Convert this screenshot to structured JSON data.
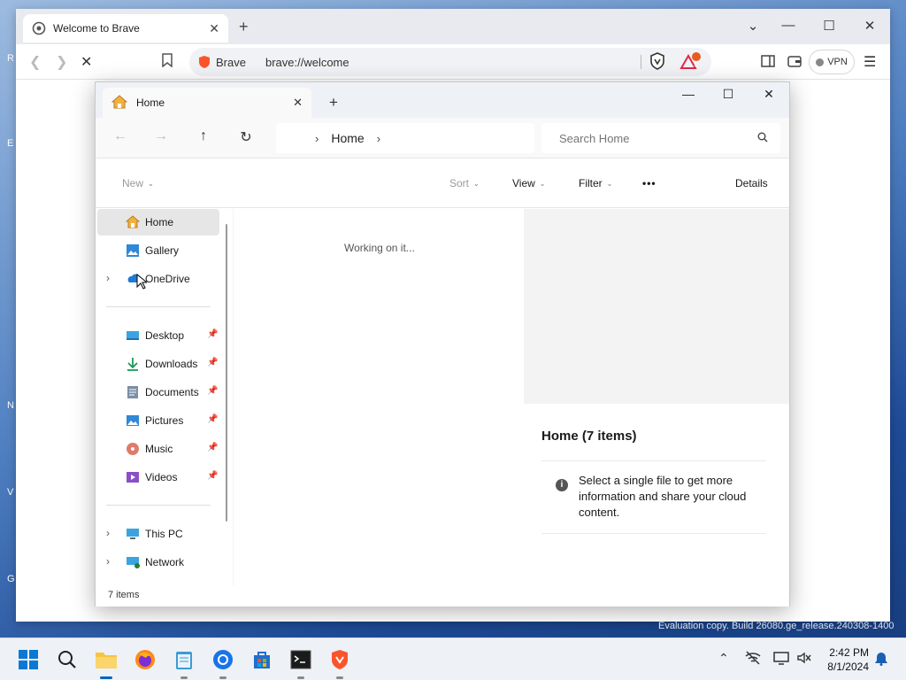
{
  "desktop": {
    "fragments": [
      "R",
      "E",
      "N",
      "V",
      "G"
    ]
  },
  "browser": {
    "tab_title": "Welcome to Brave",
    "site_label": "Brave",
    "url": "brave://welcome",
    "vpn_label": "VPN",
    "rewards_badge": "1",
    "icons": [
      "brave-icon",
      "close-icon",
      "plus-icon",
      "minimize-icon",
      "maximize-icon",
      "back-icon",
      "forward-icon",
      "stop-icon",
      "bookmark-icon",
      "shield-icon",
      "rewards-icon",
      "sidebar-icon",
      "wallet-icon",
      "menu-icon"
    ]
  },
  "explorer": {
    "tab_title": "Home",
    "breadcrumb": "Home",
    "search_placeholder": "Search Home",
    "commands": {
      "new": "New",
      "sort": "Sort",
      "view": "View",
      "filter": "Filter",
      "more": "•••",
      "details": "Details"
    },
    "sidebar": {
      "top": [
        {
          "label": "Home",
          "icon": "home-icon",
          "selected": true
        },
        {
          "label": "Gallery",
          "icon": "gallery-icon"
        },
        {
          "label": "OneDrive",
          "icon": "onedrive-icon",
          "expandable": true
        }
      ],
      "pinned": [
        {
          "label": "Desktop",
          "icon": "desktop-icon"
        },
        {
          "label": "Downloads",
          "icon": "downloads-icon"
        },
        {
          "label": "Documents",
          "icon": "documents-icon"
        },
        {
          "label": "Pictures",
          "icon": "pictures-icon"
        },
        {
          "label": "Music",
          "icon": "music-icon"
        },
        {
          "label": "Videos",
          "icon": "videos-icon"
        }
      ],
      "bottom": [
        {
          "label": "This PC",
          "icon": "this-pc-icon",
          "expandable": true
        },
        {
          "label": "Network",
          "icon": "network-icon",
          "expandable": true
        }
      ]
    },
    "content_status": "Working on it...",
    "details": {
      "title": "Home (7 items)",
      "message": "Select a single file to get more information and share your cloud content."
    },
    "status_bar": "7 items"
  },
  "watermark": "Evaluation copy. Build 26080.ge_release.240308-1400",
  "taskbar": {
    "apps": [
      "start-icon",
      "search-icon",
      "file-explorer-icon",
      "firefox-icon",
      "notepad-icon",
      "chrome-icon",
      "store-icon",
      "terminal-icon",
      "brave-icon"
    ],
    "time": "2:42 PM",
    "date": "8/1/2024",
    "colors": {
      "accent": "#0067c0"
    }
  }
}
